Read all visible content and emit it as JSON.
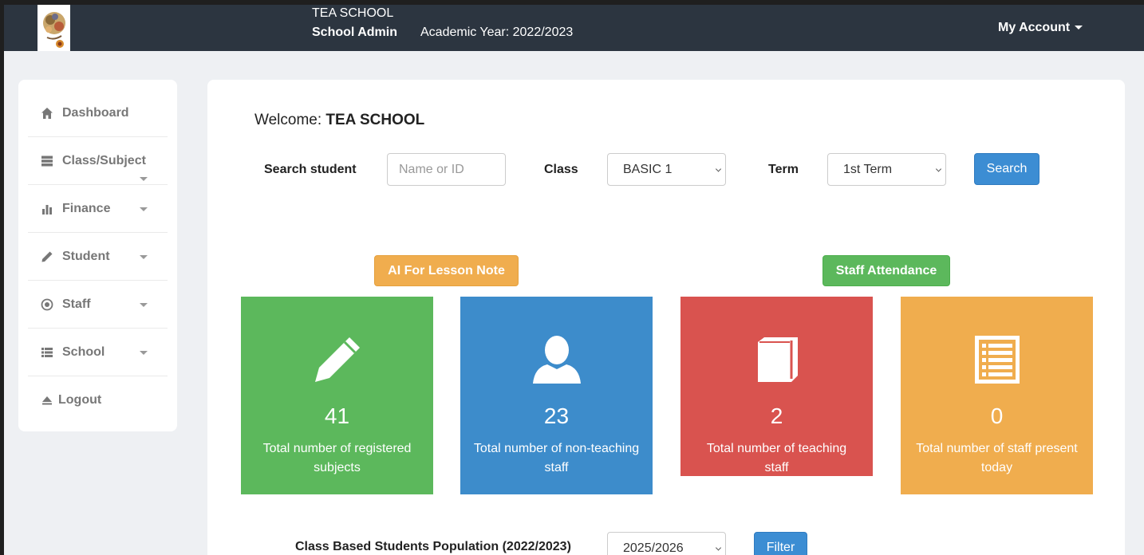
{
  "header": {
    "school_name": "TEA SCHOOL",
    "role": "School Admin",
    "academic_year": "Academic Year: 2022/2023",
    "account_label": "My Account"
  },
  "sidebar": {
    "items": [
      {
        "label": "Dashboard",
        "icon": "home-icon"
      },
      {
        "label": "Class/Subject",
        "icon": "server-icon"
      },
      {
        "label": "Finance",
        "icon": "bar-chart-icon"
      },
      {
        "label": "Student",
        "icon": "pencil-icon"
      },
      {
        "label": "Staff",
        "icon": "record-icon"
      },
      {
        "label": "School",
        "icon": "list-icon"
      },
      {
        "label": "Logout",
        "icon": "eject-icon"
      }
    ]
  },
  "main": {
    "welcome_prefix": "Welcome:",
    "welcome_name": "TEA SCHOOL",
    "search": {
      "label": "Search student",
      "placeholder": "Name or ID",
      "class_label": "Class",
      "class_value": "BASIC 1",
      "term_label": "Term",
      "term_value": "1st Term",
      "button": "Search"
    },
    "actions": {
      "ai_button": "AI For Lesson Note",
      "attendance_button": "Staff Attendance"
    },
    "tiles": [
      {
        "value": "41",
        "desc": "Total number of registered subjects",
        "icon": "pencil-icon",
        "color": "#5cb85c"
      },
      {
        "value": "23",
        "desc": "Total number of non-teaching staff",
        "icon": "user-icon",
        "color": "#3d8ccb"
      },
      {
        "value": "2",
        "desc": "Total number of teaching staff",
        "icon": "book-icon",
        "color": "#d9534f"
      },
      {
        "value": "0",
        "desc": "Total number of staff present today",
        "icon": "list-alt-icon",
        "color": "#f0ad4e"
      }
    ],
    "population": {
      "label": "Class Based Students Population (2022/2023)",
      "year_value": "2025/2026",
      "button": "Filter"
    }
  }
}
